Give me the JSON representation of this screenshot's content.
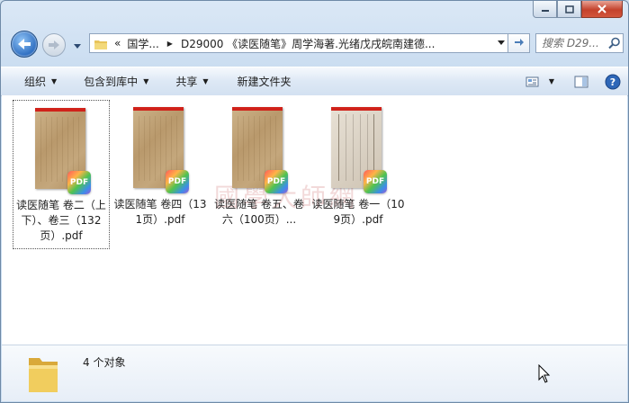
{
  "address": {
    "overflow": "«",
    "crumbs": [
      "国学...",
      "D29000 《读医随笔》周学海著.光绪戊戌皖南建德..."
    ]
  },
  "search": {
    "placeholder": "搜索 D29..."
  },
  "toolbar": {
    "organize": "组织",
    "include_library": "包含到库中",
    "share": "共享",
    "new_folder": "新建文件夹"
  },
  "files": [
    {
      "name": "读医随笔  卷二（上下）、卷三（132页）.pdf",
      "badge": "PDF"
    },
    {
      "name": "读医随笔  卷四（131页）.pdf",
      "badge": "PDF"
    },
    {
      "name": "读医随笔  卷五、卷六（100页）...",
      "badge": "PDF"
    },
    {
      "name": "读医随笔  卷一（109页）.pdf",
      "badge": "PDF"
    }
  ],
  "watermark": "國學大師網",
  "status": {
    "count": "4 个对象"
  },
  "colors": {
    "pdf_strip": "#d0221a",
    "window_frame": "#6f8aa7",
    "close_button": "#c4422c"
  }
}
